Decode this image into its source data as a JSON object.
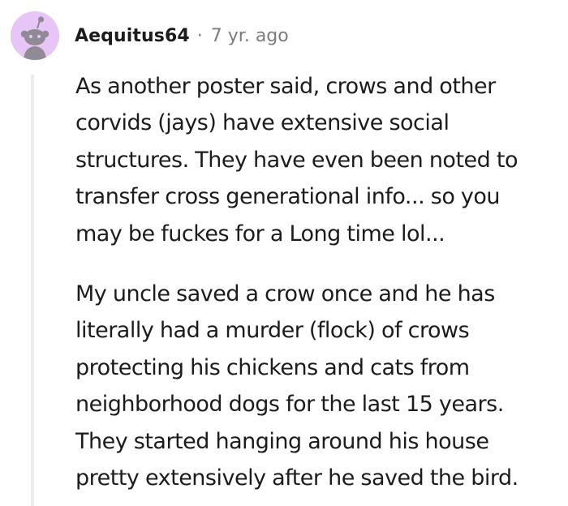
{
  "comment": {
    "username": "Aequitus64",
    "separator": "·",
    "timestamp": "7 yr. ago",
    "avatar_icon": "snoo-avatar-icon",
    "colors": {
      "avatar_bg": "#e7c5f6",
      "avatar_fg": "#8f8a96",
      "thread_line": "#ececec",
      "meta_text": "#7c7c7c",
      "body_text": "#1c1c1c"
    },
    "paragraphs": [
      {
        "lines": [
          "As another poster said, crows and other",
          "corvids (jays) have extensive social",
          "structures. They have even been noted to",
          "transfer cross generational info... so you",
          "may be fuckes for a Long time lol..."
        ]
      },
      {
        "lines": [
          "My uncle saved a crow once and he has",
          "literally had a murder (flock) of crows",
          "protecting his chickens and cats from",
          "neighborhood dogs for the last 15 years.",
          "They started hanging around his house",
          "pretty extensively after he saved the bird."
        ]
      }
    ]
  }
}
